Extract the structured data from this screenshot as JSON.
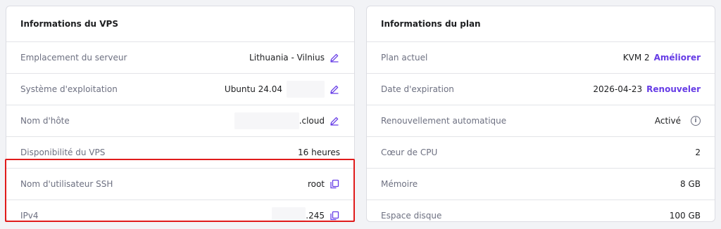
{
  "vps_card": {
    "title": "Informations du VPS",
    "rows": [
      {
        "label": "Emplacement du serveur",
        "value": "Lithuania - Vilnius"
      },
      {
        "label": "Système d'exploitation",
        "value": "Ubuntu 24.04"
      },
      {
        "label": "Nom d'hôte",
        "value": ".cloud"
      },
      {
        "label": "Disponibilité du VPS",
        "value": "16 heures"
      },
      {
        "label": "Nom d'utilisateur SSH",
        "value": "root"
      },
      {
        "label": "IPv4",
        "value": ".245"
      }
    ]
  },
  "plan_card": {
    "title": "Informations du plan",
    "rows": [
      {
        "label": "Plan actuel",
        "value": "KVM 2",
        "action": "Améliorer"
      },
      {
        "label": "Date d'expiration",
        "value": "2026-04-23",
        "action": "Renouveler"
      },
      {
        "label": "Renouvellement automatique",
        "value": "Activé"
      },
      {
        "label": "Cœur de CPU",
        "value": "2"
      },
      {
        "label": "Mémoire",
        "value": "8 GB"
      },
      {
        "label": "Espace disque",
        "value": "100 GB"
      }
    ]
  },
  "colors": {
    "accent": "#673de6",
    "highlight": "#e01b1b"
  },
  "icons": {
    "edit": "pencil-icon",
    "copy": "copy-icon",
    "info": "info-icon"
  }
}
